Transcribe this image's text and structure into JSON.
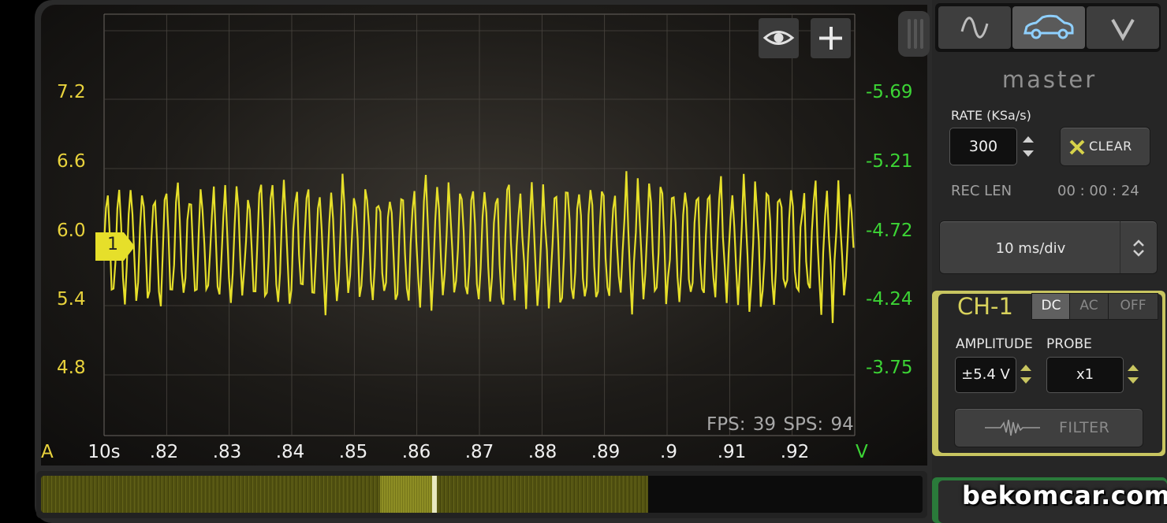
{
  "scope": {
    "left_axis_unit": "A",
    "right_axis_unit": "V",
    "left_ticks": [
      "7.2",
      "6.6",
      "6.0",
      "5.4",
      "4.8"
    ],
    "right_ticks": [
      "-5.69",
      "-5.21",
      "-4.72",
      "-4.24",
      "-3.75"
    ],
    "x_ticks": [
      "10s",
      ".82",
      ".83",
      ".84",
      ".85",
      ".86",
      ".87",
      ".88",
      ".89",
      ".9",
      ".91",
      ".92"
    ],
    "fps_label": "FPS: 39",
    "sps_label": "SPS: 94",
    "channel_marker": "1",
    "trace_color": "#e6df2a"
  },
  "toolbar": {
    "eye_icon": "eye-icon",
    "plus_icon": "plus-icon"
  },
  "tabs": [
    {
      "icon": "sine-wave-icon"
    },
    {
      "icon": "car-icon",
      "active": true
    },
    {
      "icon": "chevron-down-icon"
    }
  ],
  "master": {
    "title": "master",
    "rate_label": "RATE (KSa/s)",
    "rate_value": "300",
    "clear_label": "CLEAR",
    "rec_len_label": "REC LEN",
    "rec_len_value": "00 : 00 : 24",
    "timebase_value": "10 ms/div"
  },
  "ch1": {
    "title": "CH-1",
    "coupling_options": [
      "DC",
      "AC",
      "OFF"
    ],
    "coupling_selected": "DC",
    "amplitude_label": "AMPLITUDE",
    "amplitude_value": "±5.4 V",
    "probe_label": "PROBE",
    "probe_value": "x1",
    "filter_label": "FILTER",
    "accent": "#c8c560"
  },
  "watermark": "bekomcar.com"
}
